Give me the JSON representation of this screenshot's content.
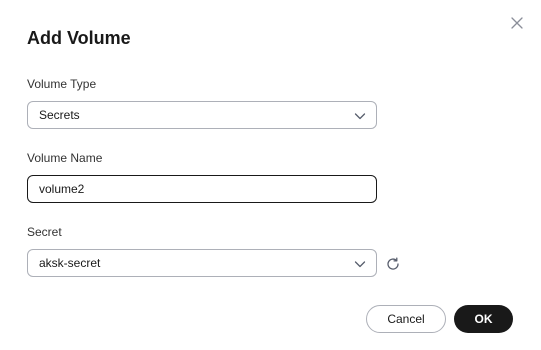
{
  "dialog": {
    "title": "Add Volume",
    "close_icon": "close-icon"
  },
  "form": {
    "volume_type": {
      "label": "Volume Type",
      "value": "Secrets"
    },
    "volume_name": {
      "label": "Volume Name",
      "value": "volume2"
    },
    "secret": {
      "label": "Secret",
      "value": "aksk-secret",
      "refresh_icon": "refresh-icon"
    }
  },
  "footer": {
    "cancel_label": "Cancel",
    "ok_label": "OK"
  },
  "colors": {
    "primary_button": "#191919",
    "border": "#adb0b8"
  }
}
